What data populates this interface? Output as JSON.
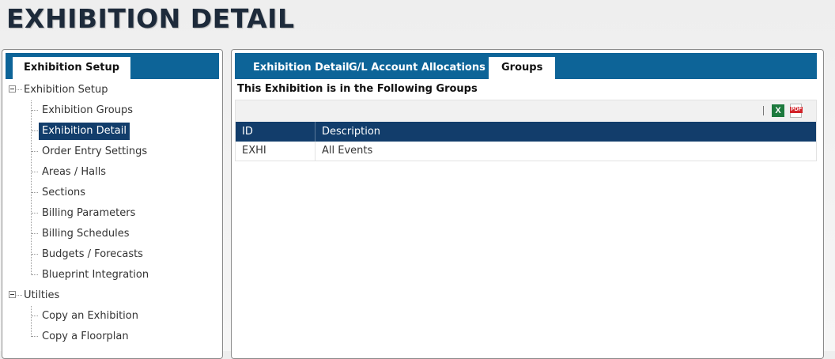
{
  "page": {
    "title": "EXHIBITION DETAIL"
  },
  "left": {
    "tab_label": "Exhibition Setup",
    "tree": [
      {
        "label": "Exhibition Setup",
        "children": [
          "Exhibition Groups",
          "Exhibition Detail",
          "Order Entry Settings",
          "Areas / Halls",
          "Sections",
          "Billing Parameters",
          "Billing Schedules",
          "Budgets / Forecasts",
          "Blueprint Integration"
        ]
      },
      {
        "label": "Utilties",
        "children": [
          "Copy an Exhibition",
          "Copy a Floorplan"
        ]
      }
    ],
    "selected": "Exhibition Detail"
  },
  "right": {
    "tabs": [
      "Exhibition Detail",
      "G/L Account Allocations",
      "Groups"
    ],
    "active_tab": "Groups",
    "section_title": "This Exhibition is in the Following Groups",
    "toolbar": {
      "excel_icon": "excel-export-icon",
      "pdf_icon": "pdf-export-icon",
      "pdf_text": "PDF",
      "excel_text": "X"
    },
    "grid": {
      "columns": [
        "ID",
        "Description"
      ],
      "rows": [
        [
          "EXHI",
          "All Events"
        ]
      ]
    }
  },
  "colors": {
    "tab_bar": "#0d6498",
    "header_navy": "#123d6b",
    "selected_bg": "#123d6b"
  }
}
